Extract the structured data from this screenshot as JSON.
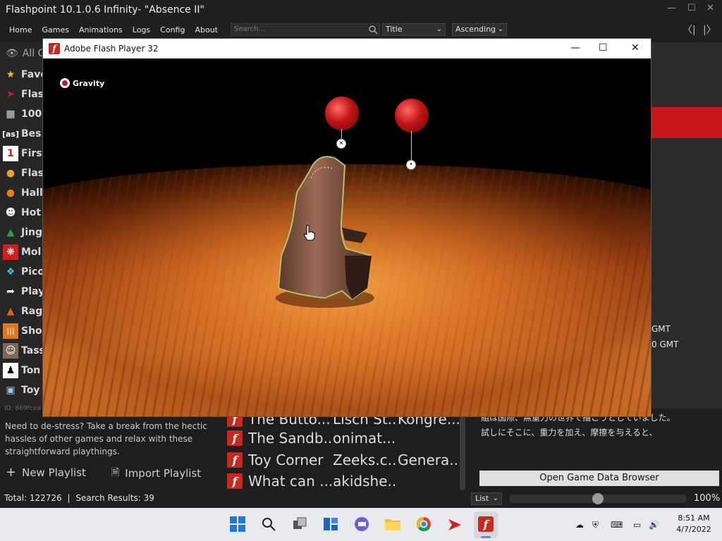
{
  "launcher": {
    "title": "Flashpoint 10.1.0.6 Infinity- \"Absence II\"",
    "menu": [
      "Home",
      "Games",
      "Animations",
      "Logs",
      "Config",
      "About"
    ],
    "search_placeholder": "Search...",
    "sort_field": "Title",
    "sort_order": "Ascending"
  },
  "sidebar": {
    "all_label": "All G",
    "playlists": [
      {
        "label": "Favo",
        "icon": "star-icon"
      },
      {
        "label": "Flas",
        "icon": "flashpoint-icon"
      },
      {
        "label": "100",
        "icon": "invader-icon"
      },
      {
        "label": "Bes",
        "icon": "as-icon"
      },
      {
        "label": "First",
        "icon": "number-one-icon"
      },
      {
        "label": "Flas",
        "icon": "burger-icon"
      },
      {
        "label": "Hall",
        "icon": "pumpkin-icon"
      },
      {
        "label": "Hot",
        "icon": "face-icon"
      },
      {
        "label": "Jing",
        "icon": "tree-icon"
      },
      {
        "label": "Mol",
        "icon": "molecule-icon"
      },
      {
        "label": "Pico",
        "icon": "pixels-icon"
      },
      {
        "label": "Play",
        "icon": "share-icon"
      },
      {
        "label": "Rag",
        "icon": "fire-icon"
      },
      {
        "label": "Sho",
        "icon": "waveform-icon"
      },
      {
        "label": "Tass",
        "icon": "portrait-icon"
      },
      {
        "label": "Ton",
        "icon": "silhouette-icon"
      },
      {
        "label": "Toy",
        "icon": "blocks-icon"
      }
    ],
    "id_text": "ID: 869fcea",
    "description": "Need to de-stress? Take a break from the hectic hassles of other games and relax with these straightforward playthings.",
    "new_playlist": "New Playlist",
    "import_playlist": "Import Playlist"
  },
  "status": {
    "total": "Total: 122726",
    "separator": "|",
    "results": "Search Results: 39"
  },
  "game_list": [
    {
      "title": "The Butto...",
      "dev": "Lisch St...",
      "pub": "Kongre..."
    },
    {
      "title": "The Sandb...",
      "dev": "onimat...",
      "pub": ""
    },
    {
      "title": "Toy Corner",
      "dev": "Zeeks.c...",
      "pub": "Genera..."
    },
    {
      "title": "What can ...",
      "dev": "akidshe...",
      "pub": ""
    }
  ],
  "right_panel": {
    "gmt1": "GMT",
    "gmt2": "0 GMT",
    "jp1": "組は国際、無重力の世界で描こうとしていました。",
    "jp2": "試しにそこに、重力を加え、摩擦を与えると、",
    "open_browser": "Open Game Data Browser",
    "view_mode": "List",
    "zoom": "100%"
  },
  "flash_player": {
    "title": "Adobe Flash Player 32",
    "gravity_label": "Gravity"
  },
  "taskbar": {
    "time": "8:51 AM",
    "date": "4/7/2022"
  },
  "colors": {
    "accent_red": "#c9161c",
    "flash_red": "#c8281e",
    "dark_bg": "#1e1e1e"
  }
}
